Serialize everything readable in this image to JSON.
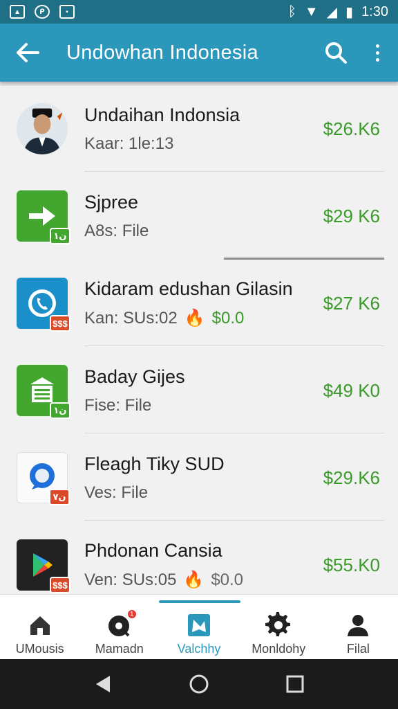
{
  "status_bar": {
    "time": "1:30",
    "left_icons": [
      "image-icon",
      "messenger-icon",
      "photo-icon"
    ],
    "right_icons": [
      "bluetooth-icon",
      "wifi-icon",
      "signal-icon",
      "battery-icon"
    ]
  },
  "app_bar": {
    "title": "Undowhan Indonesia",
    "icons": [
      "back-arrow-icon",
      "search-icon",
      "more-vert-icon"
    ]
  },
  "colors": {
    "app_bar": "#2a97bb",
    "status_bar": "#1f6f86",
    "price": "#3a9a2a"
  },
  "list": {
    "items": [
      {
        "title": "Undaihan Indonsia",
        "subtitle": "Kaar: 1le:13",
        "price": "$26.K6",
        "icon": "avatar"
      },
      {
        "title": "Sjpree",
        "subtitle": "A8s: File",
        "price": "$29 K6",
        "icon": "arrow-app-icon",
        "badge": "ن١"
      },
      {
        "title": "Kidaram edushan Gilasin",
        "subtitle": "Kan: SUs:02",
        "sub_price": "$0.0",
        "price": "$27 K6",
        "icon": "phone-app-icon",
        "badge": "$$$"
      },
      {
        "title": "Baday Gijes",
        "subtitle": "Fise: File",
        "price": "$49 K0",
        "icon": "document-app-icon",
        "badge": "ن١"
      },
      {
        "title": "Fleagh Tiky SUD",
        "subtitle": "Ves: File",
        "price": "$29.K6",
        "icon": "chat-app-icon",
        "badge": "ن٧"
      },
      {
        "title": "Phdonan Cansia",
        "subtitle": "Ven: SUs:05",
        "sub_price": "$0.0",
        "price": "$55.K0",
        "icon": "play-app-icon",
        "badge": "$$$"
      }
    ]
  },
  "bottom_nav": {
    "items": [
      {
        "label": "UMousis",
        "icon": "home-icon"
      },
      {
        "label": "Mamadn",
        "icon": "music-icon",
        "badge": "1"
      },
      {
        "label": "Valchhy",
        "icon": "share-app-icon",
        "active": true
      },
      {
        "label": "Monldohy",
        "icon": "settings-icon"
      },
      {
        "label": "Filal",
        "icon": "person-icon"
      }
    ]
  }
}
